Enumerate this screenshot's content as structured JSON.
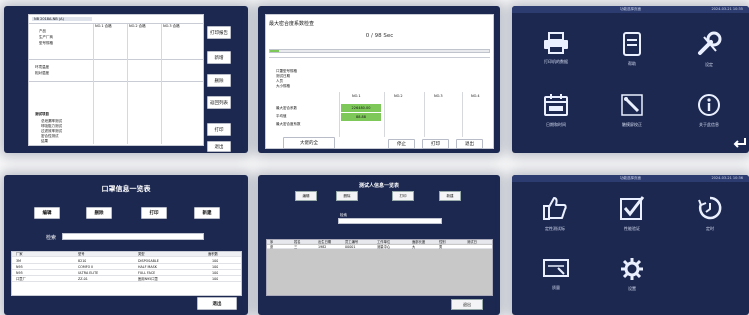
{
  "p1": {
    "header_code": "NB 2018A-NB (A)",
    "buttons": [
      "打印报告",
      "新增",
      "删除",
      "返回列表",
      "打印",
      "退出"
    ],
    "row_labels": [
      "产品",
      "生产厂商",
      "型号规格",
      "环境温度",
      "相对湿度",
      "测试项目",
      "总泄漏率测试",
      "呼吸阻力测试",
      "过滤效率测试",
      "密合性测试",
      "结果"
    ],
    "col_heads": [
      "NO.1 合格",
      "NO.2 合格",
      "NO.3 合格"
    ]
  },
  "p2": {
    "title": "最大密合度系数检查",
    "progress_text": "0 / 98 Sec",
    "progress_fraction": 0.04,
    "info_rows": [
      "口罩型号规格",
      "测试日期",
      "人员",
      "大小规格"
    ],
    "col_heads": [
      "NO.1",
      "NO.2",
      "NO.3",
      "NO.4"
    ],
    "result_labels": [
      "最大密合系数",
      "平均值",
      "最大密合度系数"
    ],
    "highlight_values": [
      "226480.00",
      "88.88"
    ],
    "buttons": [
      "大佬的全",
      "停止",
      "打印",
      "退出"
    ]
  },
  "p3": {
    "header_title": "功能选择页面",
    "header_time": "2024-03-21 10:35",
    "tiles": [
      "打印机的数据",
      "帮助",
      "设定",
      "日期和时间",
      "触摸屏校正",
      "关于此信息"
    ]
  },
  "p4": {
    "title": "口罩信息一览表",
    "buttons": [
      "编辑",
      "删除",
      "打印",
      "新建"
    ],
    "search_label": "检索",
    "columns": [
      "厂家",
      "型号",
      "类型",
      "面积数"
    ],
    "rows": [
      [
        "3M",
        "8210",
        "DISPOSABLE",
        "100"
      ],
      [
        "N95",
        "COMFO II",
        "HALF MASK",
        "100"
      ],
      [
        "N95",
        "ULTRA ELITE",
        "FULL FACE",
        "100"
      ],
      [
        "口罩厂",
        "ZZ-01",
        "医用N95口罩",
        "100"
      ]
    ],
    "exit": "退出"
  },
  "p5": {
    "title": "测试人信息一览表",
    "buttons": [
      "编辑",
      "删除",
      "打印",
      "新建"
    ],
    "search_label": "检索",
    "columns": [
      "序",
      "姓名",
      "出生日期",
      "员工编号",
      "工作单位",
      "面部长度",
      "性别",
      "测试日"
    ],
    "rows": [
      [
        "张",
        "三",
        "1982",
        "00001",
        "测量中心",
        "大",
        "男",
        ""
      ]
    ],
    "exit": "退出"
  },
  "p6": {
    "header_title": "功能选择页面",
    "header_time": "2024-03-21 10:36",
    "tiles": [
      "定性测试标",
      "性能验证",
      "定时",
      "质量",
      "设置"
    ]
  },
  "colors": {
    "panel": "#1c2850",
    "header": "#2c3c70",
    "accent_green": "#7ec85a"
  },
  "icons": [
    "printer-icon",
    "help-icon",
    "wrench-icon",
    "calendar-icon",
    "touch-calibrate-icon",
    "info-icon",
    "back-icon",
    "thumbs-up-icon",
    "checkbox-icon",
    "timer-icon",
    "quality-icon",
    "gear-icon"
  ]
}
